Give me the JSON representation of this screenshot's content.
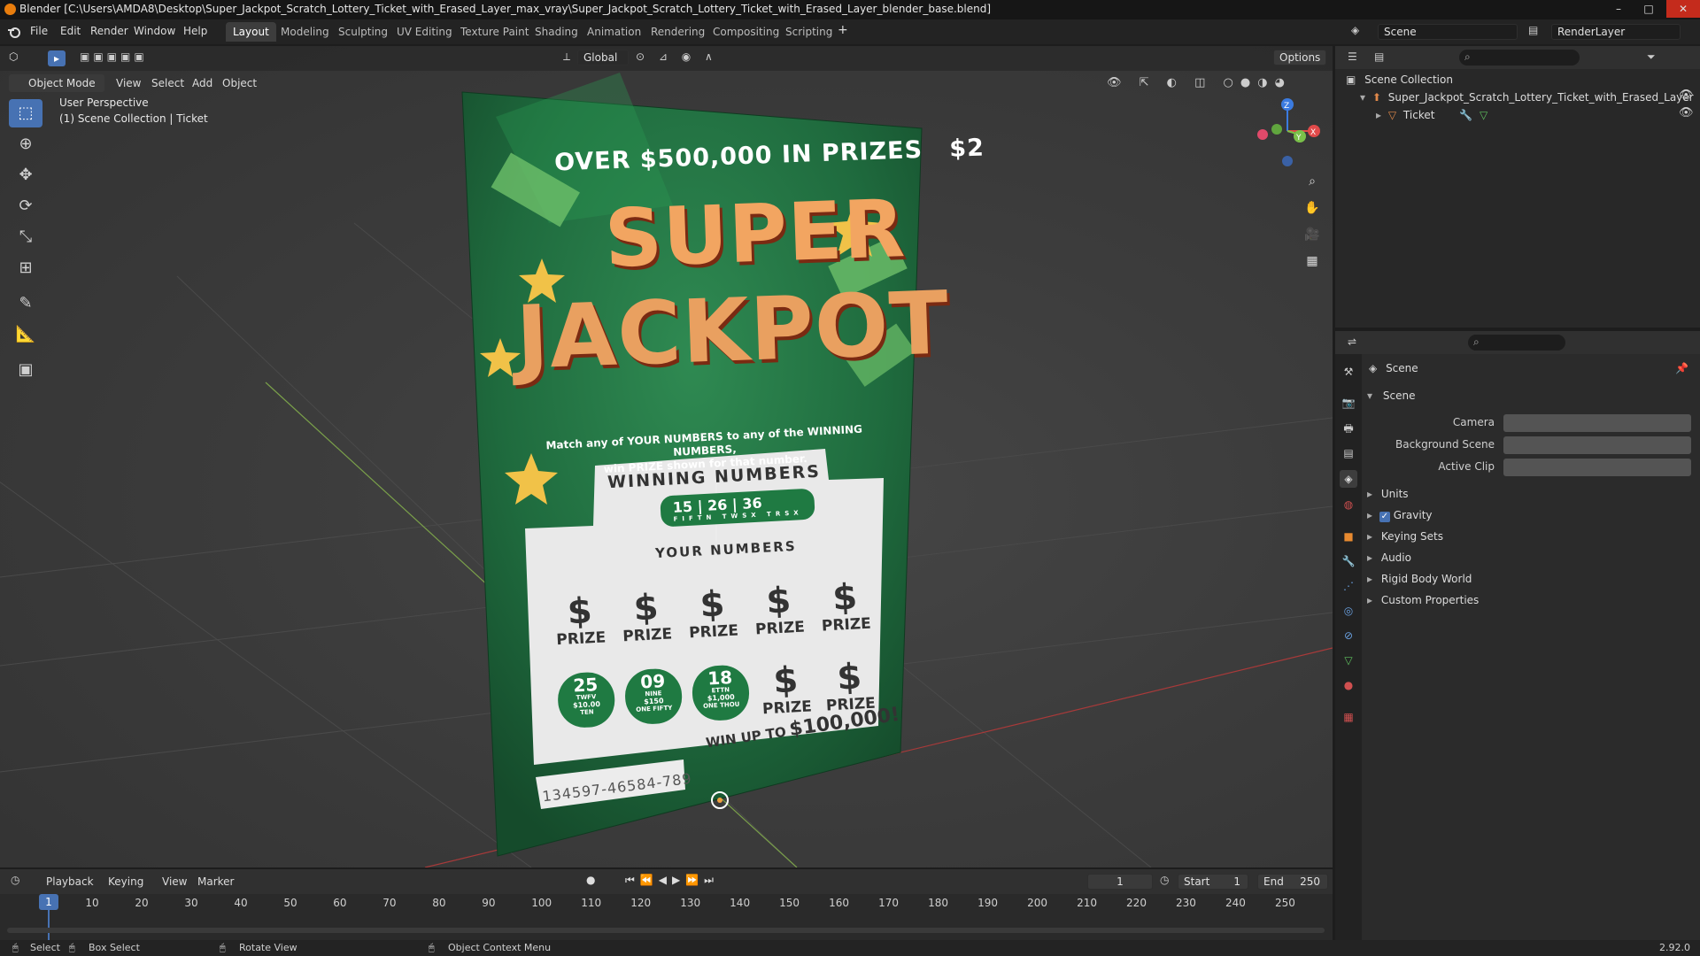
{
  "window": {
    "title": "Blender [C:\\Users\\AMDA8\\Desktop\\Super_Jackpot_Scratch_Lottery_Ticket_with_Erased_Layer_max_vray\\Super_Jackpot_Scratch_Lottery_Ticket_with_Erased_Layer_blender_base.blend]",
    "minimize": "–",
    "maximize": "□",
    "close": "✕"
  },
  "menu": [
    "File",
    "Edit",
    "Render",
    "Window",
    "Help"
  ],
  "workspaces": [
    "Layout",
    "Modeling",
    "Sculpting",
    "UV Editing",
    "Texture Paint",
    "Shading",
    "Animation",
    "Rendering",
    "Compositing",
    "Scripting"
  ],
  "workspace_add": "+",
  "scene_field": "Scene",
  "renderlayer_field": "RenderLayer",
  "viewport": {
    "mode": "Object Mode",
    "menus": [
      "View",
      "Select",
      "Add",
      "Object"
    ],
    "transform_orientation": "Global",
    "options": "Options",
    "perspective_label": "User Perspective",
    "collection_label": "(1) Scene Collection | Ticket",
    "gizmo_axes": [
      "X",
      "Y",
      "Z"
    ]
  },
  "ticket": {
    "top_text": "OVER $500,000 IN PRIZES",
    "price": "$2",
    "title_line1": "SUPER",
    "title_line2": "JACKPOT",
    "instructions_line1": "Match any of YOUR NUMBERS to any of the WINNING NUMBERS,",
    "instructions_line2": "win PRIZE shown for that number.",
    "winning_header": "WINNING NUMBERS",
    "winning_numbers": [
      "15",
      "26",
      "36"
    ],
    "winning_words": [
      "FIFTN",
      "TWSX",
      "TRSX"
    ],
    "your_header": "YOUR NUMBERS",
    "symbol": "$",
    "prize_label": "PRIZE",
    "revealed": [
      {
        "num": "25",
        "word": "TWFV",
        "amt": "$10.00",
        "amt_word": "TEN"
      },
      {
        "num": "09",
        "word": "NINE",
        "amt": "$150",
        "amt_word": "ONE FIFTY"
      },
      {
        "num": "18",
        "word": "ETTN",
        "amt": "$1,000",
        "amt_word": "ONE THOU"
      }
    ],
    "win_text": "WIN UP TO",
    "win_amount": "$100,000!",
    "serial": "134597-46584-789"
  },
  "outliner": {
    "root": "Scene Collection",
    "collection": "Super_Jackpot_Scratch_Lottery_Ticket_with_Erased_Layer",
    "object": "Ticket"
  },
  "properties": {
    "context": "Scene",
    "panel": "Scene",
    "fields": [
      "Camera",
      "Background Scene",
      "Active Clip"
    ],
    "subpanels": [
      "Units",
      "Gravity",
      "Keying Sets",
      "Audio",
      "Rigid Body World",
      "Custom Properties"
    ]
  },
  "timeline": {
    "menus": [
      "Playback",
      "Keying",
      "View",
      "Marker"
    ],
    "current_frame": "1",
    "start_label": "Start",
    "start": "1",
    "end_label": "End",
    "end": "250",
    "ticks": [
      "1",
      "10",
      "20",
      "30",
      "40",
      "50",
      "60",
      "70",
      "80",
      "90",
      "100",
      "110",
      "120",
      "130",
      "140",
      "150",
      "160",
      "170",
      "180",
      "190",
      "200",
      "210",
      "220",
      "230",
      "240",
      "250"
    ]
  },
  "status": {
    "select": "Select",
    "box_select": "Box Select",
    "rotate_view": "Rotate View",
    "context_menu": "Object Context Menu",
    "version": "2.92.0"
  },
  "colors": {
    "accent": "#4772b3",
    "ticket_green": "#1f6b3e",
    "title_gold": "#f0b25a"
  }
}
